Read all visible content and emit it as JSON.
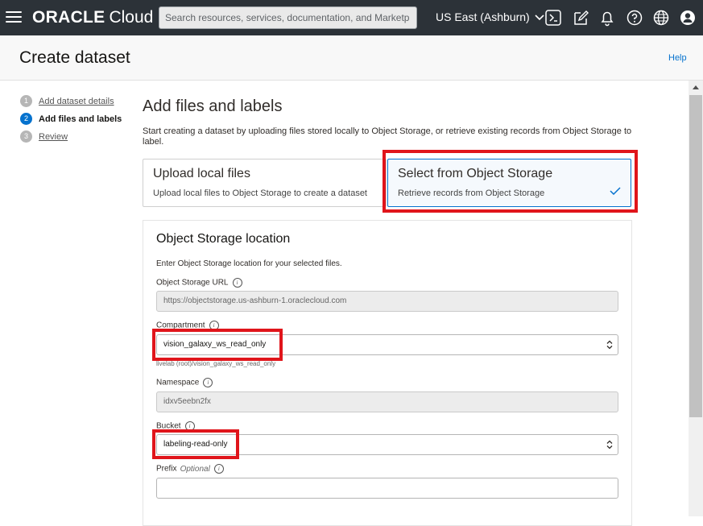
{
  "topbar": {
    "logo_brand": "ORACLE",
    "logo_product": "Cloud",
    "search_placeholder": "Search resources, services, documentation, and Marketp",
    "region": "US East (Ashburn)",
    "icons": [
      "cloud-shell-icon",
      "edit-icon",
      "bell-icon",
      "help-icon",
      "globe-icon",
      "user-icon"
    ]
  },
  "header": {
    "title": "Create dataset",
    "help": "Help"
  },
  "steps": [
    {
      "num": "1",
      "label": "Add dataset details",
      "state": "done"
    },
    {
      "num": "2",
      "label": "Add files and labels",
      "state": "active"
    },
    {
      "num": "3",
      "label": "Review",
      "state": "todo"
    }
  ],
  "main": {
    "title": "Add files and labels",
    "intro": "Start creating a dataset by uploading files stored locally to Object Storage, or retrieve existing records from Object Storage to label.",
    "options": [
      {
        "title": "Upload local files",
        "desc": "Upload local files to Object Storage to create a dataset",
        "selected": false
      },
      {
        "title": "Select from Object Storage",
        "desc": "Retrieve records from Object Storage",
        "selected": true
      }
    ]
  },
  "panel": {
    "title": "Object Storage location",
    "desc": "Enter Object Storage location for your selected files.",
    "url_label": "Object Storage URL",
    "url_value": "https://objectstorage.us-ashburn-1.oraclecloud.com",
    "compartment_label": "Compartment",
    "compartment_value": "vision_galaxy_ws_read_only",
    "compartment_path": "livelab (root)/vision_galaxy_ws_read_only",
    "namespace_label": "Namespace",
    "namespace_value": "idxv5eebn2fx",
    "bucket_label": "Bucket",
    "bucket_value": "labeling-read-only",
    "prefix_label": "Prefix",
    "prefix_optional": "Optional",
    "prefix_value": ""
  },
  "colors": {
    "topbar": "#2c3238",
    "accent": "#0572ce",
    "highlight": "#e0151b"
  }
}
